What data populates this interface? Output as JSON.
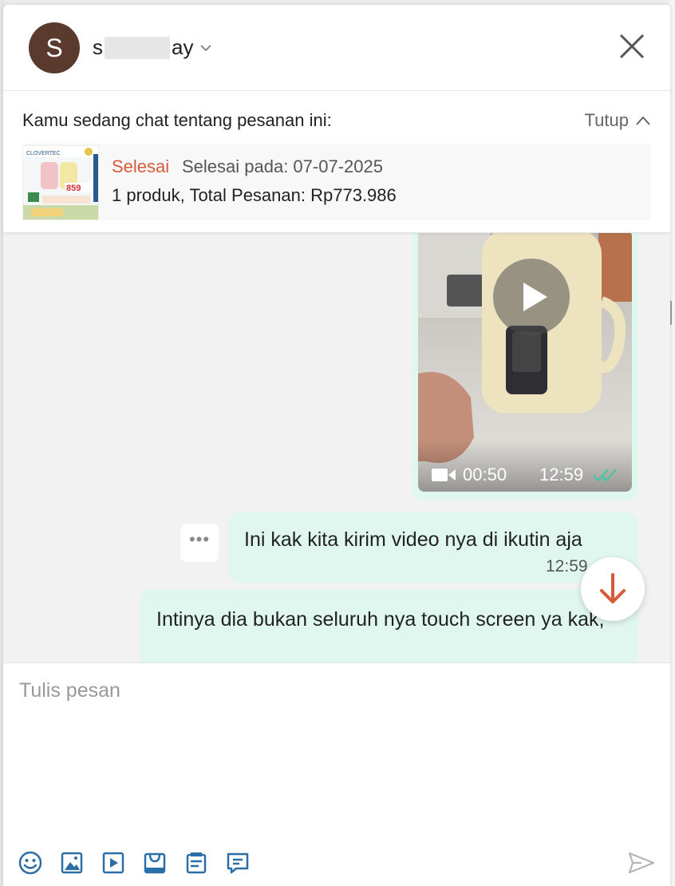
{
  "header": {
    "avatar_letter": "S",
    "username_start": "s",
    "username_end": "ay"
  },
  "order": {
    "title": "Kamu sedang chat tentang pesanan ini:",
    "close_label": "Tutup",
    "status": "Selesai",
    "completed_on": "Selesai pada: 07-07-2025",
    "summary": "1 produk, Total Pesanan: Rp773.986",
    "thumb_brand": "CLOVERTEC",
    "thumb_price": "859"
  },
  "messages": {
    "video": {
      "duration": "00:50",
      "time": "12:59"
    },
    "msg1": {
      "text": "Ini kak kita kirim video nya di ikutin aja",
      "time": "12:59"
    },
    "msg2": {
      "text": "Intinya dia bukan seluruh nya touch screen ya kak,"
    }
  },
  "composer": {
    "placeholder": "Tulis pesan",
    "icons": [
      "emoji-icon",
      "image-icon",
      "video-icon",
      "product-icon",
      "order-icon",
      "quick-reply-icon",
      "send-icon"
    ]
  },
  "colors": {
    "accent": "#d55a3a",
    "bubble": "#e0f7ef",
    "tick": "#3ec7a6"
  }
}
